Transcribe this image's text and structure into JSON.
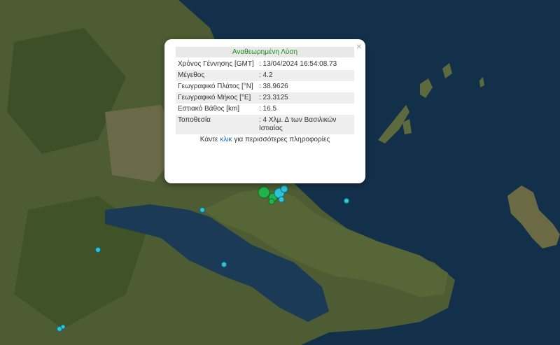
{
  "popup": {
    "title": "Αναθεωρημένη Λύση",
    "close_label": "×",
    "rows": [
      {
        "label": "Χρόνος Γέννησης [GMT]",
        "value": ": 13/04/2024 16:54:08.73"
      },
      {
        "label": "Μέγεθος",
        "value": ": 4.2"
      },
      {
        "label": "Γεωγραφικό Πλάτος [°N]",
        "value": ": 38.9626"
      },
      {
        "label": "Γεωγραφικό Μήκος [°E]",
        "value": ": 23.3125"
      },
      {
        "label": "Εστιακό Βάθος [km]",
        "value": ": 16.5"
      },
      {
        "label": "Τοποθεσία",
        "value": ": 4 Χλμ. Δ των Βασιλικών Ιστιαίας"
      }
    ],
    "more_prefix": "Κάντε",
    "more_link": "κλικ",
    "more_suffix": "για περισσότερες πληροφορίες"
  },
  "colors": {
    "sea": "#13304a",
    "land": "#4a5a30",
    "marker": "#2ec4d4",
    "cluster": "#21b24a",
    "title_green": "#1e8c1e",
    "link": "#1565c0"
  },
  "icons": [
    "close-icon",
    "earthquake-marker-icon"
  ]
}
